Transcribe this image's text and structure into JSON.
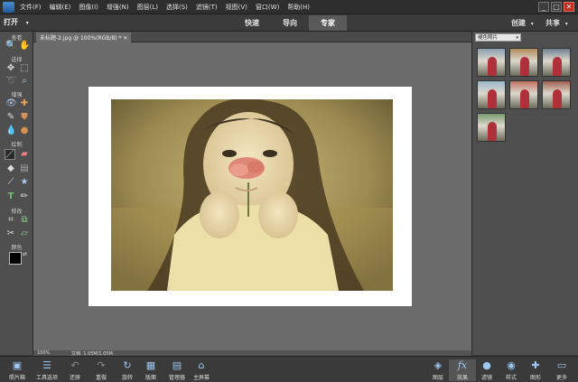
{
  "menubar": {
    "items": [
      "文件(F)",
      "编辑(E)",
      "图像(I)",
      "增强(N)",
      "图层(L)",
      "选择(S)",
      "滤镜(T)",
      "视图(V)",
      "窗口(W)",
      "帮助(H)"
    ],
    "window_controls": [
      "_",
      "□",
      "✕"
    ]
  },
  "modebar": {
    "open_label": "打开",
    "tabs": [
      "快速",
      "导向",
      "专家"
    ],
    "active_tab": "专家",
    "create_label": "创建",
    "share_label": "共享"
  },
  "toolbox": {
    "sections": [
      "查看",
      "选择",
      "增强",
      "绘制",
      "修改",
      "颜色"
    ]
  },
  "document": {
    "tab_label": "未标题-2.jpg @ 100%(RGB/8) * ✕",
    "zoom": "100%",
    "doc_info": "文档: 1.05M/1.05M"
  },
  "right_panel": {
    "dropdown_value": "褪色照片"
  },
  "taskbar": {
    "left_items": [
      "照片箱",
      "工具选项",
      "还原",
      "重做",
      "旋转",
      "版面",
      "管理器",
      "主屏幕"
    ],
    "right_items": [
      "图层",
      "效果",
      "滤镜",
      "样式",
      "图形",
      "更多"
    ]
  },
  "colors": {
    "accent": "#5a5a5a",
    "icon_blue": "#9cc6f0",
    "photo_tint": "#b9a56a"
  }
}
